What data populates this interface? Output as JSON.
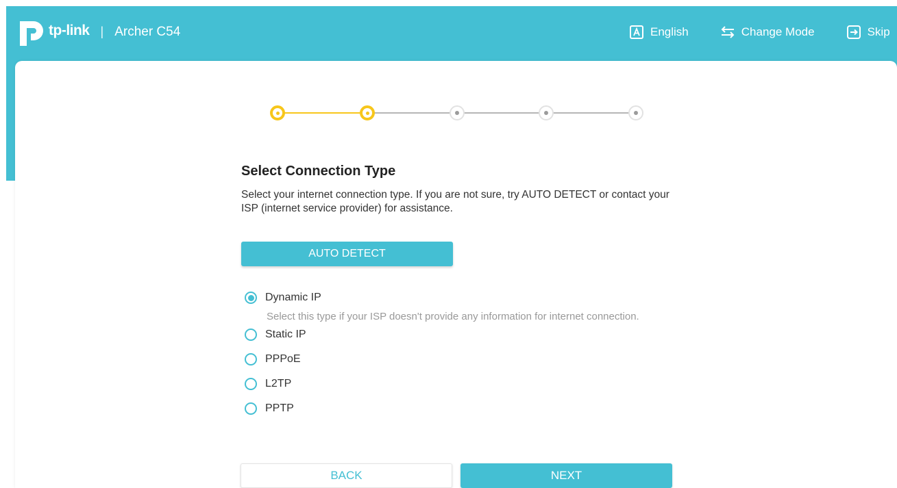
{
  "header": {
    "brand": "tp-link",
    "separator": "|",
    "model": "Archer C54",
    "actions": {
      "language_label": "English",
      "language_icon": "language-a-icon",
      "change_mode_label": "Change Mode",
      "change_mode_icon": "swap-arrows-icon",
      "skip_label": "Skip",
      "skip_icon": "exit-arrow-icon"
    }
  },
  "stepper": {
    "total_steps": 5,
    "completed_steps": 2
  },
  "main": {
    "title": "Select Connection Type",
    "description": "Select your internet connection type. If you are not sure, try AUTO DETECT or contact your ISP (internet service provider) for assistance.",
    "auto_detect_label": "AUTO DETECT",
    "options": [
      {
        "label": "Dynamic IP",
        "selected": true,
        "help": "Select this type if your ISP doesn't provide any information for internet connection."
      },
      {
        "label": "Static IP",
        "selected": false
      },
      {
        "label": "PPPoE",
        "selected": false
      },
      {
        "label": "L2TP",
        "selected": false
      },
      {
        "label": "PPTP",
        "selected": false
      }
    ]
  },
  "footer": {
    "back_label": "BACK",
    "next_label": "NEXT"
  },
  "colors": {
    "accent": "#44bfd3",
    "step_done": "#f7c61b",
    "step_todo": "#9b9b9b",
    "help_text": "#999999"
  }
}
